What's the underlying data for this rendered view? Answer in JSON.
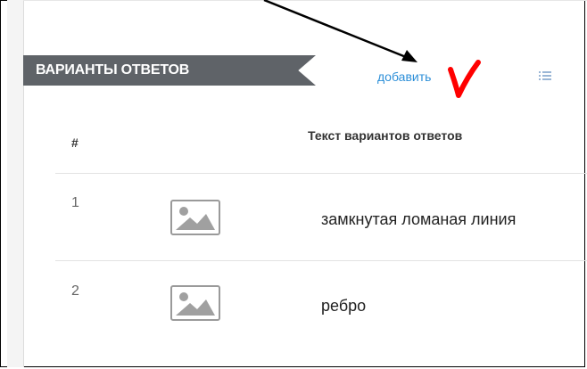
{
  "section": {
    "title": "ВАРИАНТЫ ОТВЕТОВ"
  },
  "toolbar": {
    "add_label": "добавить",
    "list_icon": "list-icon"
  },
  "table": {
    "headers": {
      "number": "#",
      "text": "Текст вариантов ответов"
    },
    "rows": [
      {
        "number": "1",
        "image_icon": "image-placeholder-icon",
        "text": "замкнутая ломаная линия"
      },
      {
        "number": "2",
        "image_icon": "image-placeholder-icon",
        "text": "ребро"
      }
    ]
  },
  "colors": {
    "section_band": "#5f6368",
    "link": "#2d8fd8",
    "annotation_arrow": "#000000",
    "annotation_check": "#ff0000"
  }
}
